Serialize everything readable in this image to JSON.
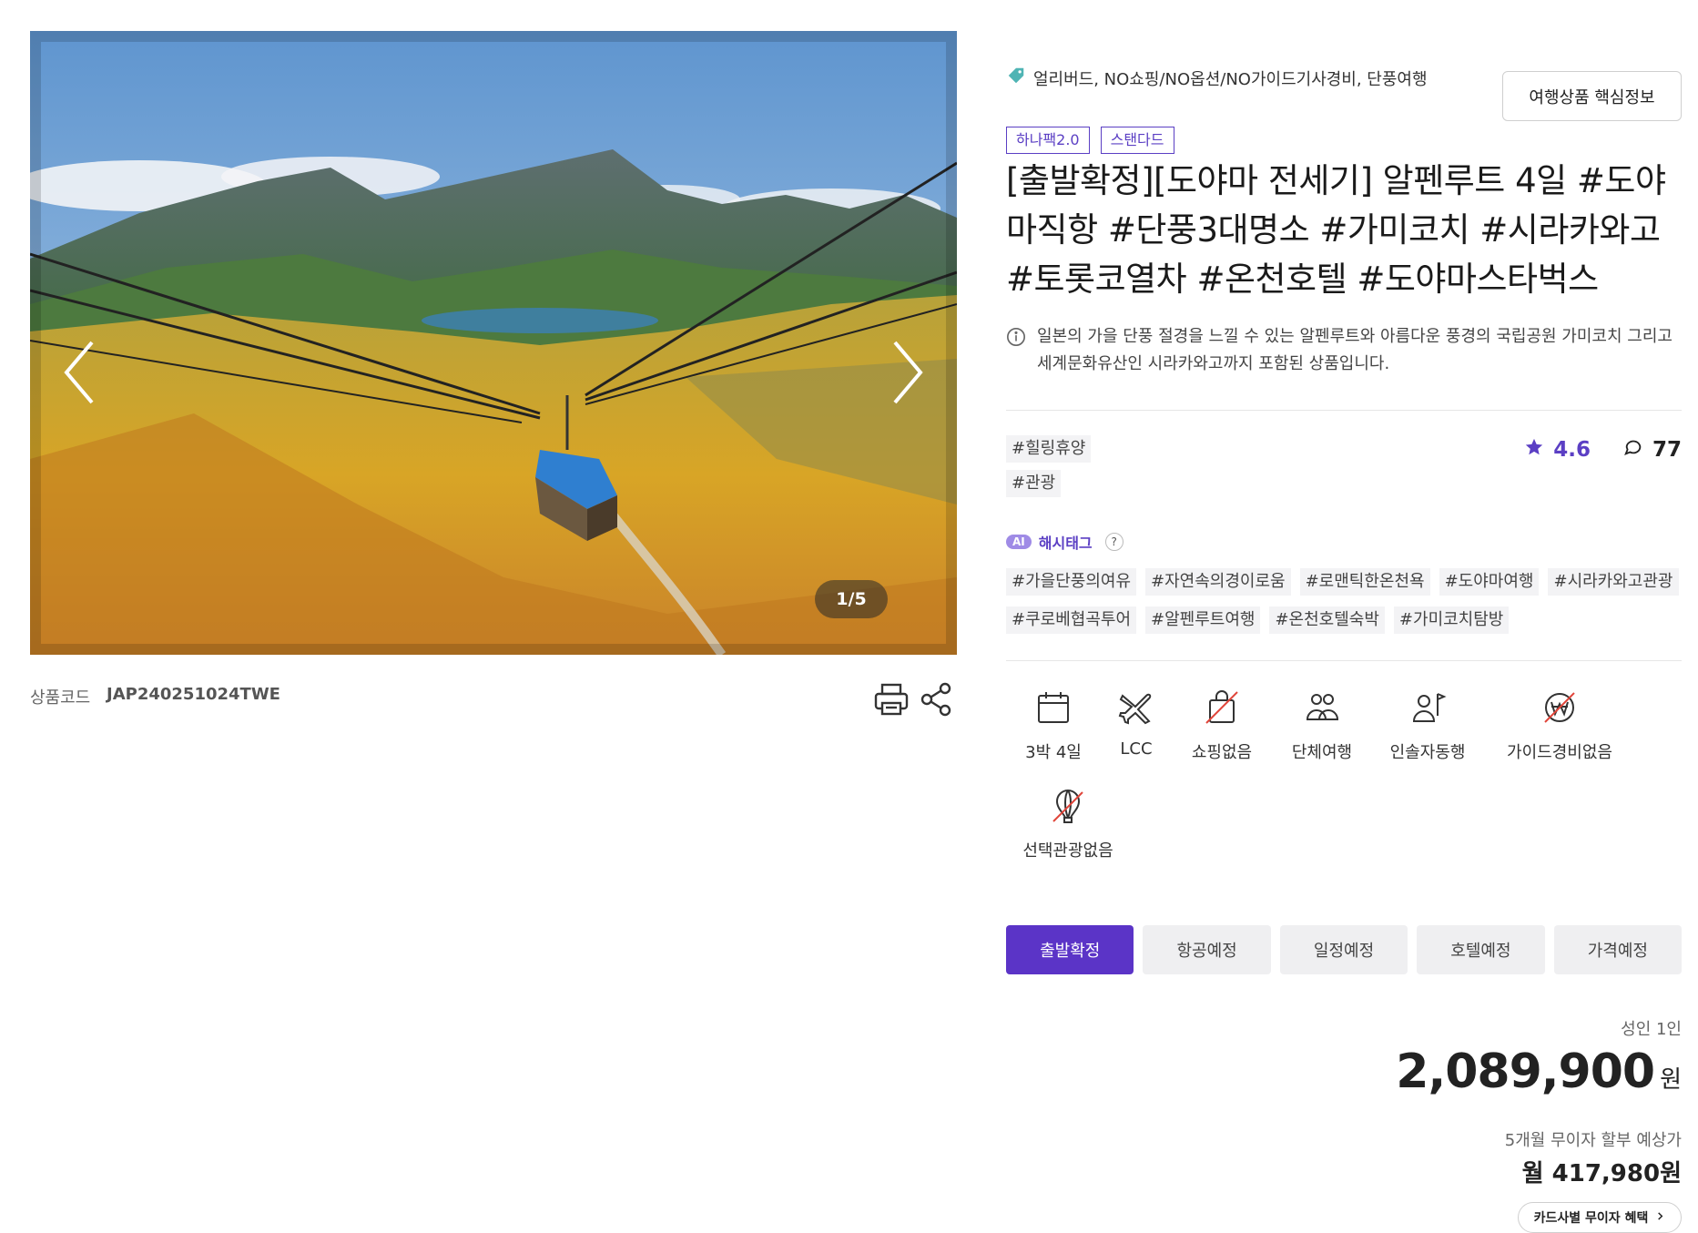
{
  "gallery": {
    "counter": "1/5",
    "product_code_label": "상품코드",
    "product_code": "JAP240251024TWE"
  },
  "product": {
    "features_line": "얼리버드, NO쇼핑/NO옵션/NO가이드기사경비, 단풍여행",
    "core_info_button": "여행상품 핵심정보",
    "badges": [
      "하나팩2.0",
      "스탠다드"
    ],
    "title": "[출발확정][도야마 전세기] 알펜루트 4일 #도야마직항 #단풍3대명소 #가미코치 #시라카와고 #토롯코열차 #온천호텔 #도야마스타벅스",
    "description": "일본의 가을 단풍 절경을 느낄 수 있는 알펜루트와 아름다운 풍경의 국립공원 가미코치 그리고 세계문화유산인 시라카와고까지 포함된 상품입니다.",
    "tags": [
      "#힐링휴양",
      "#관광"
    ],
    "rating": "4.6",
    "review_count": "77"
  },
  "ai_hashtags": {
    "chip": "AI",
    "title": "해시태그",
    "help": "?",
    "items": [
      "#가을단풍의여유",
      "#자연속의경이로움",
      "#로맨틱한온천욕",
      "#도야마여행",
      "#시라카와고관광",
      "#쿠로베협곡투어",
      "#알펜루트여행",
      "#온천호텔숙박",
      "#가미코치탐방"
    ]
  },
  "features": [
    {
      "icon": "calendar-icon",
      "label": "3박 4일"
    },
    {
      "icon": "airplane-icon",
      "label": "LCC"
    },
    {
      "icon": "no-shopping-icon",
      "label": "쇼핑없음"
    },
    {
      "icon": "group-icon",
      "label": "단체여행"
    },
    {
      "icon": "tour-guide-icon",
      "label": "인솔자동행"
    },
    {
      "icon": "no-guide-fee-icon",
      "label": "가이드경비없음"
    },
    {
      "icon": "no-optional-tour-icon",
      "label": "선택관광없음"
    }
  ],
  "status_tabs": [
    "출발확정",
    "항공예정",
    "일정예정",
    "호텔예정",
    "가격예정"
  ],
  "pricing": {
    "adult_label": "성인 1인",
    "price": "2,089,900",
    "currency": "원",
    "installment_label": "5개월 무이자 할부 예상가",
    "installment_price": "월 417,980원",
    "card_benefit_button": "카드사별 무이자 혜택"
  },
  "colors": {
    "accent": "#5b34c7",
    "rating_star": "#5b3fc4"
  }
}
